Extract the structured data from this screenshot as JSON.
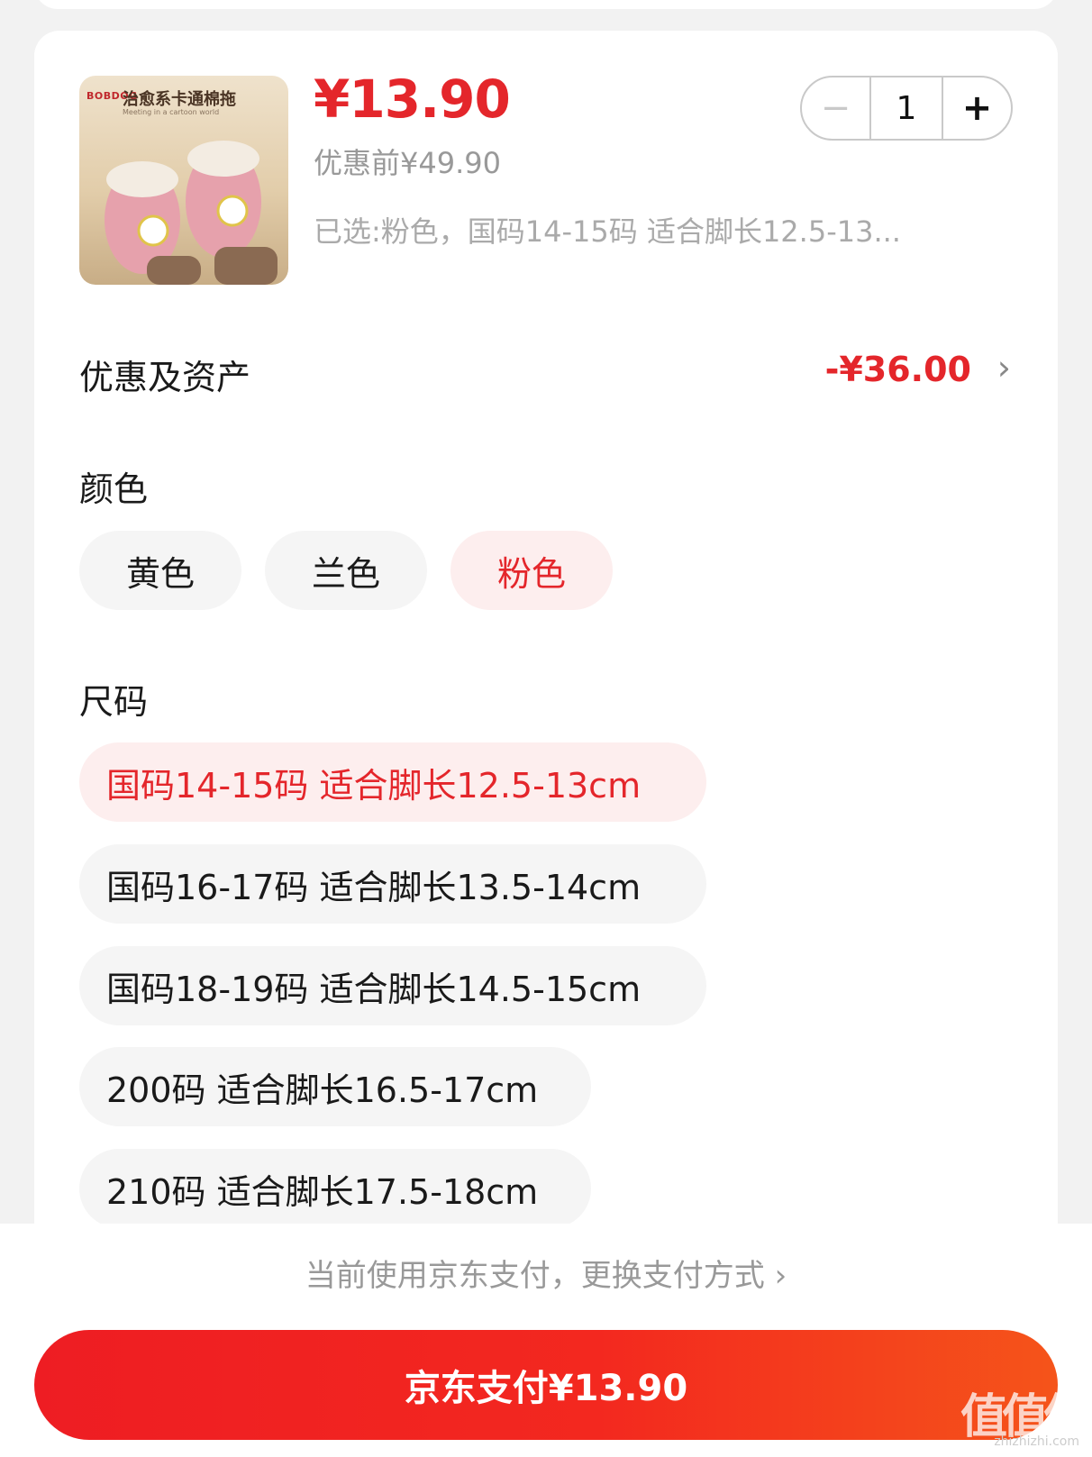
{
  "product": {
    "image_brand": "BOBDOG",
    "image_title": "治愈系卡通棉拖",
    "image_subtitle": "Meeting in a cartoon world",
    "price": "¥13.90",
    "original_price": "优惠前¥49.90",
    "selected_summary": "已选:粉色，国码14-15码 适合脚长12.5-13...",
    "quantity": "1"
  },
  "discount": {
    "label": "优惠及资产",
    "value": "-¥36.00"
  },
  "color": {
    "label": "颜色",
    "options": [
      "黄色",
      "兰色",
      "粉色"
    ],
    "selected": "粉色"
  },
  "size": {
    "label": "尺码",
    "options": [
      "国码14-15码  适合脚长12.5-13cm",
      "国码16-17码  适合脚长13.5-14cm",
      "国码18-19码  适合脚长14.5-15cm",
      "200码  适合脚长16.5-17cm",
      "210码  适合脚长17.5-18cm"
    ],
    "selected": "国码14-15码  适合脚长12.5-13cm"
  },
  "payment": {
    "hint": "当前使用京东支付，更换支付方式",
    "button": "京东支付¥13.90"
  },
  "watermark": {
    "logo": "值值值",
    "site": "zhizhizhi.com"
  },
  "colors": {
    "accent": "#e4262b",
    "selected_chip_bg": "#fdeeee",
    "chip_bg": "#f5f5f5"
  }
}
